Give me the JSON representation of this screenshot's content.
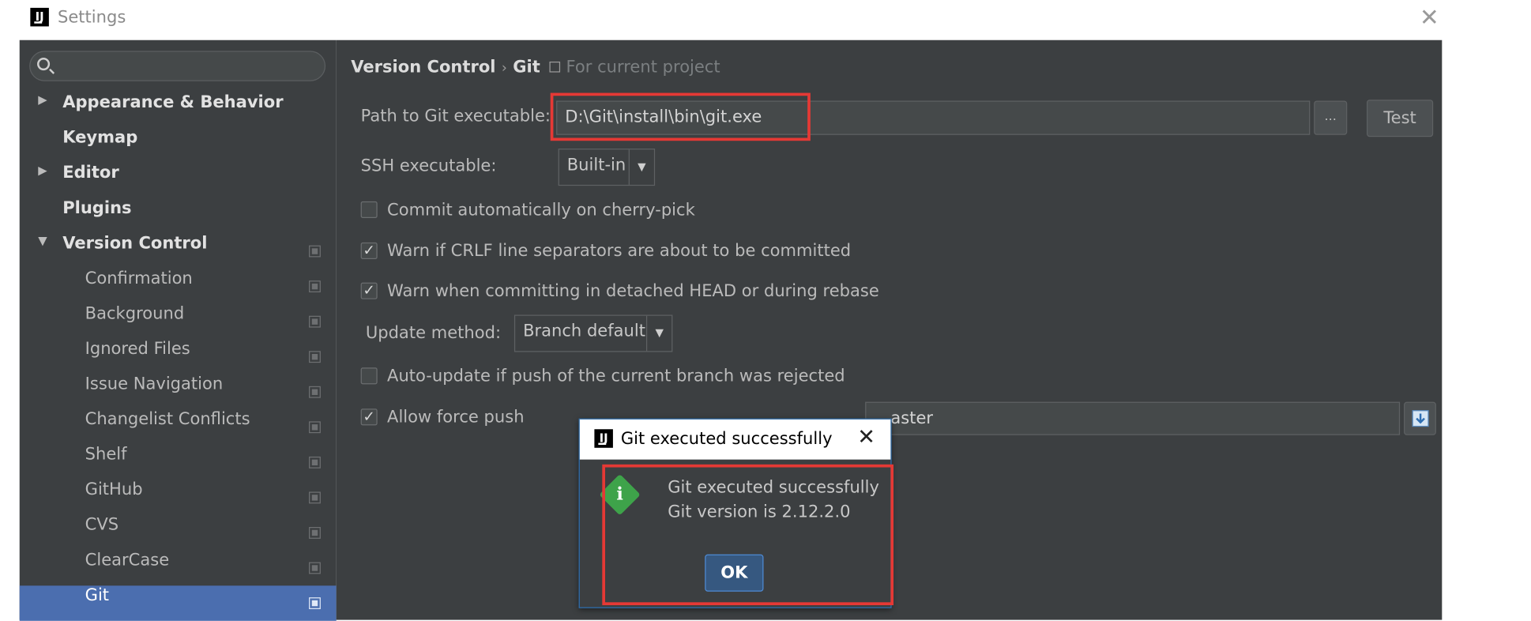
{
  "window": {
    "title": "Settings",
    "logo_text": "IJ"
  },
  "sidebar": {
    "search": {
      "placeholder": ""
    },
    "items": [
      {
        "label": "Appearance & Behavior",
        "arrow": "▶"
      },
      {
        "label": "Keymap"
      },
      {
        "label": "Editor",
        "arrow": "▶"
      },
      {
        "label": "Plugins"
      },
      {
        "label": "Version Control",
        "arrow": "▼"
      },
      {
        "label": "Confirmation"
      },
      {
        "label": "Background"
      },
      {
        "label": "Ignored Files"
      },
      {
        "label": "Issue Navigation"
      },
      {
        "label": "Changelist Conflicts"
      },
      {
        "label": "Shelf"
      },
      {
        "label": "GitHub"
      },
      {
        "label": "CVS"
      },
      {
        "label": "ClearCase"
      },
      {
        "label": "Git",
        "selected": true
      }
    ]
  },
  "breadcrumb": {
    "parent": "Version Control",
    "separator": "›",
    "current": "Git",
    "scope": "For current project"
  },
  "git": {
    "path_label": "Path to Git executable:",
    "path_value": "D:\\Git\\install\\bin\\git.exe",
    "browse_label": "...",
    "test_label": "Test",
    "ssh_label": "SSH executable:",
    "ssh_value": "Built-in",
    "checkbox_cherry_pick": {
      "label": "Commit automatically on cherry-pick",
      "checked": false
    },
    "checkbox_crlf": {
      "label": "Warn if CRLF line separators are about to be committed",
      "checked": true
    },
    "checkbox_detached": {
      "label": "Warn when committing in detached HEAD or during rebase",
      "checked": true
    },
    "update_method_label": "Update method:",
    "update_method_value": "Branch default",
    "checkbox_auto_update": {
      "label": "Auto-update if push of the current branch was rejected",
      "checked": false
    },
    "checkbox_force_push": {
      "label": "Allow force push",
      "checked": true
    },
    "protected_branches_value": "aster",
    "check_mark": "✓",
    "dropdown_arrow": "▼"
  },
  "dialog": {
    "title": "Git executed successfully",
    "close": "✕",
    "icon_glyph": "i",
    "message_line1": "Git executed successfully",
    "message_line2": "Git version is 2.12.2.0",
    "ok_label": "OK"
  },
  "colors": {
    "panel_bg": "#3c3f41",
    "selection": "#4b6eaf",
    "highlight_box": "#e53935",
    "info_icon": "#3ea34a",
    "ok_button": "#365880"
  },
  "icons": {
    "search": "search-icon",
    "window_close": "close-icon",
    "project_scope": "project-scope-icon",
    "info": "info-icon",
    "protected_branch_action": "download-icon"
  }
}
